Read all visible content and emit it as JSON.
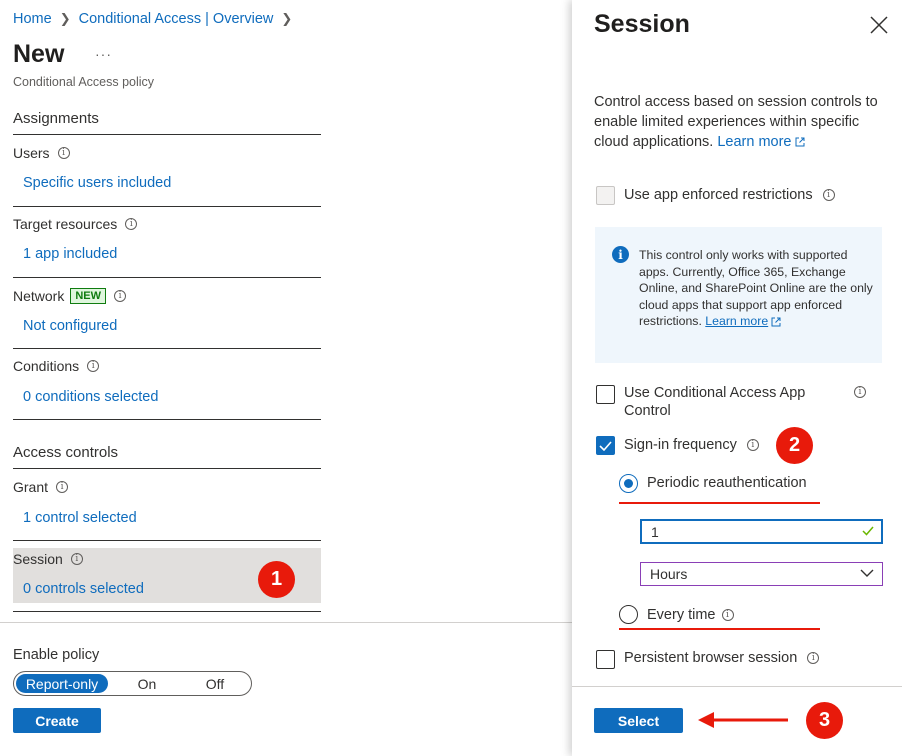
{
  "breadcrumb": {
    "home": "Home",
    "overview": "Conditional Access | Overview"
  },
  "page": {
    "title": "New",
    "more": "···",
    "subtitle": "Conditional Access policy"
  },
  "assignments": {
    "heading": "Assignments",
    "users": {
      "label": "Users",
      "value": "Specific users included"
    },
    "targets": {
      "label": "Target resources",
      "value": "1 app included"
    },
    "network": {
      "label": "Network",
      "badge": "NEW",
      "value": "Not configured"
    },
    "conditions": {
      "label": "Conditions",
      "value": "0 conditions selected"
    }
  },
  "access_controls": {
    "heading": "Access controls",
    "grant": {
      "label": "Grant",
      "value": "1 control selected"
    },
    "session": {
      "label": "Session",
      "value": "0 controls selected"
    }
  },
  "enable_policy": {
    "label": "Enable policy",
    "options": [
      "Report-only",
      "On",
      "Off"
    ],
    "selected": "Report-only"
  },
  "create_button": "Create",
  "annotations": {
    "one": "1",
    "two": "2",
    "three": "3",
    "color": "#e81a0b"
  },
  "panel": {
    "title": "Session",
    "description": "Control access based on session controls to enable limited experiences within specific cloud applications.",
    "learn_more": "Learn more",
    "app_enforced": {
      "label": "Use app enforced restrictions",
      "checked": false,
      "disabled": true
    },
    "info_text": "This control only works with supported apps. Currently, Office 365, Exchange Online, and SharePoint Online are the only cloud apps that support app enforced restrictions.",
    "info_learn_more": "Learn more",
    "app_control": {
      "label": "Use Conditional Access App Control",
      "checked": false
    },
    "signin_frequency": {
      "label": "Sign-in frequency",
      "checked": true
    },
    "periodic": {
      "label": "Periodic reauthentication",
      "selected": true
    },
    "frequency_value": "1",
    "frequency_unit": "Hours",
    "every_time": {
      "label": "Every time",
      "selected": false
    },
    "persistent": {
      "label": "Persistent browser session",
      "checked": false
    },
    "select_button": "Select"
  },
  "colors": {
    "accent": "#0f6cbd",
    "link": "#0f6cbd",
    "new_badge": "#107c10"
  },
  "icons": [
    "chevron-right-icon",
    "info-icon",
    "close-icon",
    "external-link-icon",
    "checkmark-icon",
    "chevron-down-icon",
    "arrow-left-icon"
  ]
}
